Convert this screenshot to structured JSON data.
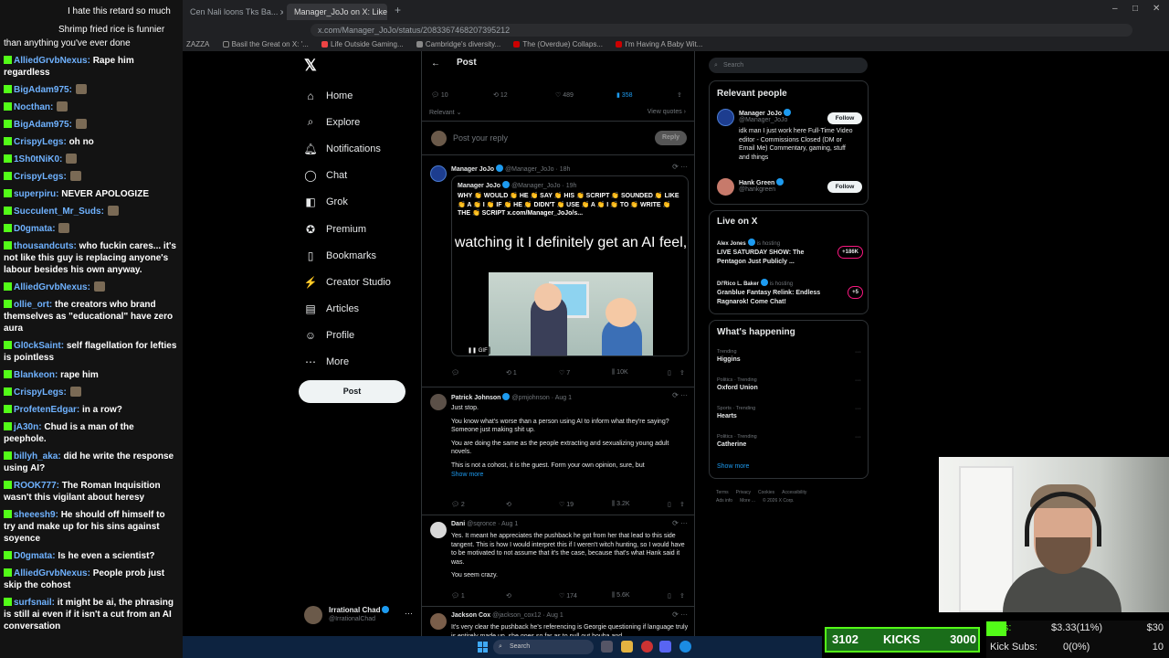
{
  "browser": {
    "tabs": [
      "Cen Nali loons Tks Ba... x",
      "Manager_JoJo on X: Like Ah..."
    ],
    "url": "x.com/Manager_JoJo/status/2083367468207395212",
    "bookmarks": [
      "ZAZZA",
      "Basil the Great on X: '...",
      "Life Outside Gaming...",
      "Cambridge's diversity...",
      "The (Overdue) Collaps...",
      "I'm Having A Baby Wit..."
    ]
  },
  "chat": {
    "top_lines": [
      {
        "name": "",
        "text": "I hate this retard so much"
      },
      {
        "name": "",
        "text": "Shrimp fried rice is funnier"
      },
      {
        "name": "",
        "text": "than anything you've ever done"
      }
    ],
    "messages": [
      {
        "name": "AlliedGrvbNexus:",
        "color": "#6fb2ff",
        "text": "Rape him regardless"
      },
      {
        "name": "BigAdam975:",
        "color": "#6fb2ff",
        "text": ""
      },
      {
        "name": "Nocthan:",
        "color": "#6fb2ff",
        "text": ""
      },
      {
        "name": "BigAdam975:",
        "color": "#6fb2ff",
        "text": ""
      },
      {
        "name": "CrispyLegs:",
        "color": "#6fb2ff",
        "text": "oh no"
      },
      {
        "name": "1Sh0tNiK0:",
        "color": "#6fb2ff",
        "text": ""
      },
      {
        "name": "CrispyLegs:",
        "color": "#6fb2ff",
        "text": ""
      },
      {
        "name": "superpiru:",
        "color": "#6fb2ff",
        "text": "NEVER APOLOGIZE"
      },
      {
        "name": "Succulent_Mr_Suds:",
        "color": "#6fb2ff",
        "text": ""
      },
      {
        "name": "D0gmata:",
        "color": "#6fb2ff",
        "text": ""
      },
      {
        "name": "thousandcuts:",
        "color": "#6fb2ff",
        "text": "who fuckin cares... it's not like this guy is replacing anyone's labour besides his own anyway."
      },
      {
        "name": "AlliedGrvbNexus:",
        "color": "#6fb2ff",
        "text": ""
      },
      {
        "name": "ollie_ort:",
        "color": "#6fb2ff",
        "text": "the creators who brand themselves as \"educational\" have zero aura"
      },
      {
        "name": "Gl0ckSaint:",
        "color": "#6fb2ff",
        "text": "self flagellation for lefties is pointless"
      },
      {
        "name": "Blankeon:",
        "color": "#6fb2ff",
        "text": "rape him"
      },
      {
        "name": "CrispyLegs:",
        "color": "#6fb2ff",
        "text": ""
      },
      {
        "name": "ProfetenEdgar:",
        "color": "#6fb2ff",
        "text": "in a row?"
      },
      {
        "name": "jA30n:",
        "color": "#6fb2ff",
        "text": "Chud is a man of the peephole."
      },
      {
        "name": "billyh_aka:",
        "color": "#6fb2ff",
        "text": "did he write the response using AI?"
      },
      {
        "name": "ROOK777:",
        "color": "#6fb2ff",
        "text": "The Roman Inquisition wasn't this vigilant about heresy"
      },
      {
        "name": "sheeesh9:",
        "color": "#6fb2ff",
        "text": "He should off himself to try and make up for his sins against soyence"
      },
      {
        "name": "D0gmata:",
        "color": "#6fb2ff",
        "text": "Is he even a scientist?"
      },
      {
        "name": "AlliedGrvbNexus:",
        "color": "#6fb2ff",
        "text": "People prob just skip the cohost"
      },
      {
        "name": "surfsnail:",
        "color": "#6fb2ff",
        "text": "it might be ai, the phrasing is still ai even if it isn't a cut from an AI conversation"
      }
    ]
  },
  "nav": {
    "items": [
      {
        "label": "Home",
        "icon": "home-icon",
        "glyph": "⌂"
      },
      {
        "label": "Explore",
        "icon": "search-icon",
        "glyph": "⌕"
      },
      {
        "label": "Notifications",
        "icon": "bell-icon",
        "glyph": "♫"
      },
      {
        "label": "Chat",
        "icon": "chat-icon",
        "glyph": "◯"
      },
      {
        "label": "Grok",
        "icon": "grok-icon",
        "glyph": "◧"
      },
      {
        "label": "Premium",
        "icon": "premium-icon",
        "glyph": "✪"
      },
      {
        "label": "Bookmarks",
        "icon": "bookmark-icon",
        "glyph": "▯"
      },
      {
        "label": "Creator Studio",
        "icon": "creator-studio-icon",
        "glyph": "⚡"
      },
      {
        "label": "Articles",
        "icon": "articles-icon",
        "glyph": "▤"
      },
      {
        "label": "Profile",
        "icon": "profile-icon",
        "glyph": "☺"
      },
      {
        "label": "More",
        "icon": "more-icon",
        "glyph": "⋯"
      }
    ],
    "post_button": "Post",
    "profile_name": "Irrational Chad",
    "profile_handle": "@IrrationalChad"
  },
  "post": {
    "header_title": "Post",
    "stats": {
      "replies": "10",
      "reposts": "12",
      "likes": "489",
      "bookmarks": "358"
    },
    "relevant_label": "Relevant",
    "view_quotes": "View quotes",
    "reply_placeholder": "Post your reply",
    "reply_button": "Reply"
  },
  "tweets": [
    {
      "name": "Manager JoJo",
      "handle": "@Manager_JoJo",
      "time": "18h",
      "quote": {
        "name": "Manager JoJo",
        "handle": "@Manager_JoJo",
        "time": "19h",
        "text": "WHY 👏 WOULD 👏 HE 👏 SAY 👏 HIS 👏 SCRIPT 👏 SOUNDED 👏 LIKE 👏 A 👏 I 👏 IF 👏 HE 👏 DIDN'T 👏 USE 👏 A 👏 I 👏 TO 👏 WRITE 👏 THE 👏 SCRIPT x.com/Manager_JoJo/s...",
        "caption": "watching it I definitely get an AI feel,",
        "gif": "GIF"
      },
      "actions": {
        "replies": "",
        "reposts": "1",
        "likes": "7",
        "views": "10K"
      }
    },
    {
      "name": "Patrick Johnson",
      "handle": "@pmjohnson",
      "time": "Aug 1",
      "paragraphs": [
        "Just stop.",
        "You know what's worse than a person using AI to inform what they're saying? Someone just making shit up.",
        "You are doing the same as the people extracting and sexualizing young adult novels.",
        "This is not a cohost, it is the guest. Form your own opinion, sure, but"
      ],
      "show_more": "Show more",
      "actions": {
        "replies": "2",
        "reposts": "",
        "likes": "19",
        "views": "3.2K"
      }
    },
    {
      "name": "Dani",
      "handle": "@sqronce",
      "time": "Aug 1",
      "paragraphs": [
        "Yes. It meant he appreciates the pushback he got from her that lead to this side tangent. This is how I would interpret this if I weren't witch hunting, so I would have to be motivated to not assume that it's the case, because that's what Hank said it was.",
        "You seem crazy."
      ],
      "actions": {
        "replies": "1",
        "reposts": "",
        "likes": "174",
        "views": "5.6K"
      }
    },
    {
      "name": "Jackson Cox",
      "handle": "@jackson_cox12",
      "time": "Aug 1",
      "paragraphs": [
        "It's very clear the pushback he's referencing is Georgie questioning if language truly is entirely made up, she goes so far as to pull out houba and"
      ]
    }
  ],
  "right": {
    "search_placeholder": "Search",
    "relevant_people_title": "Relevant people",
    "people": [
      {
        "name": "Manager JoJo",
        "handle": "@Manager_JoJo",
        "bio": "idk man I just work here Full-Time Video editor - Commissions Closed (DM or Email Me) Commentary, gaming, stuff and things",
        "follow": "Follow"
      },
      {
        "name": "Hank Green",
        "handle": "@hankgreen",
        "bio": "",
        "follow": "Follow"
      }
    ],
    "live_title": "Live on X",
    "live": [
      {
        "host": "Alex Jones",
        "is": "is hosting",
        "title": "LIVE SATURDAY SHOW: The Pentagon Just Publicly ...",
        "count": "+186K"
      },
      {
        "host": "Di'Rico L. Baker",
        "is": "is hosting",
        "title": "Granblue Fantasy Relink: Endless Ragnarok! Come Chat!",
        "count": "+5"
      }
    ],
    "happening_title": "What's happening",
    "trends": [
      {
        "category": "Trending",
        "name": "Higgins"
      },
      {
        "category": "Politics · Trending",
        "name": "Oxford Union"
      },
      {
        "category": "Sports · Trending",
        "name": "Hearts"
      },
      {
        "category": "Politics · Trending",
        "name": "Catherine"
      }
    ],
    "show_more": "Show more",
    "footer": [
      "Terms",
      "Privacy",
      "Cookies",
      "Accessibility",
      "Ads info",
      "More ...",
      "© 2026 X Corp."
    ]
  },
  "stream": {
    "kicks_left": "3102",
    "kicks_label": "KICKS",
    "kicks_right": "3000",
    "tips_label": "Tips:",
    "tips_value": "$3.33(11%)",
    "tips_goal": "$30",
    "subs_label": "Kick Subs:",
    "subs_value": "0(0%)",
    "subs_goal": "10"
  },
  "taskbar": {
    "search": "Search"
  },
  "colors": {
    "x_blue": "#1d9bf0",
    "kick_green": "#53fc18",
    "bg": "#000000"
  }
}
